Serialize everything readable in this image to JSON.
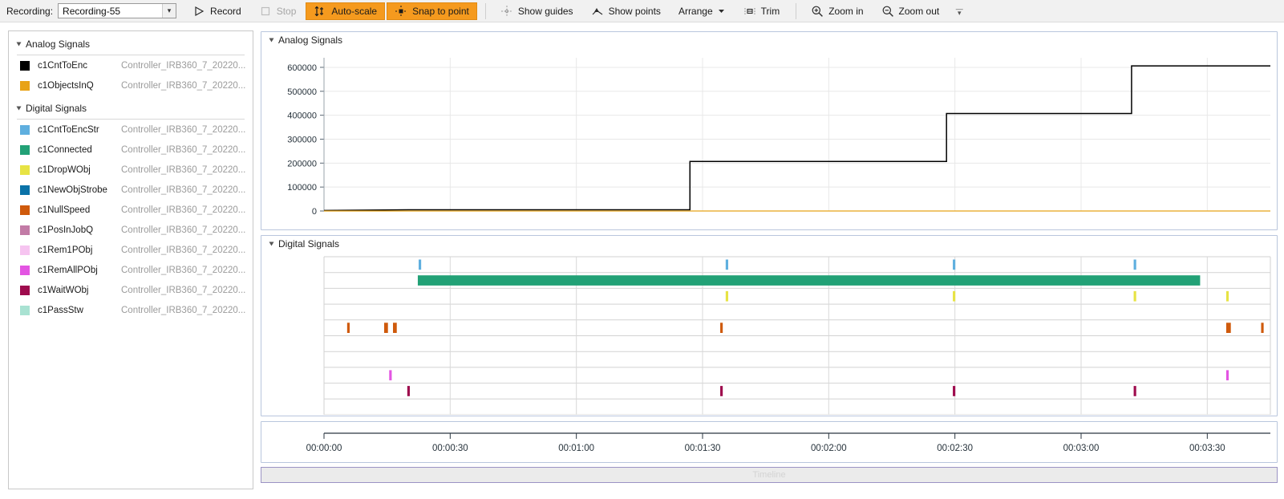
{
  "toolbar": {
    "recording_label": "Recording:",
    "recording_value": "Recording-55",
    "record_label": "Record",
    "stop_label": "Stop",
    "autoscale_label": "Auto-scale",
    "snap_label": "Snap to point",
    "show_guides_label": "Show guides",
    "show_points_label": "Show points",
    "arrange_label": "Arrange",
    "trim_label": "Trim",
    "zoom_in_label": "Zoom in",
    "zoom_out_label": "Zoom out",
    "accent_color": "#f59a1e"
  },
  "sidebar": {
    "groups": [
      {
        "title": "Analog Signals",
        "signals": [
          {
            "name": "c1CntToEnc",
            "source": "Controller_IRB360_7_20220...",
            "color": "#000000"
          },
          {
            "name": "c1ObjectsInQ",
            "source": "Controller_IRB360_7_20220...",
            "color": "#e8a317"
          }
        ]
      },
      {
        "title": "Digital Signals",
        "signals": [
          {
            "name": "c1CntToEncStr",
            "source": "Controller_IRB360_7_20220...",
            "color": "#5fafdf"
          },
          {
            "name": "c1Connected",
            "source": "Controller_IRB360_7_20220...",
            "color": "#22a176"
          },
          {
            "name": "c1DropWObj",
            "source": "Controller_IRB360_7_20220...",
            "color": "#e7e344"
          },
          {
            "name": "c1NewObjStrobe",
            "source": "Controller_IRB360_7_20220...",
            "color": "#0a72a8"
          },
          {
            "name": "c1NullSpeed",
            "source": "Controller_IRB360_7_20220...",
            "color": "#cf5a0c"
          },
          {
            "name": "c1PosInJobQ",
            "source": "Controller_IRB360_7_20220...",
            "color": "#c27ba6"
          },
          {
            "name": "c1Rem1PObj",
            "source": "Controller_IRB360_7_20220...",
            "color": "#f6c4f0"
          },
          {
            "name": "c1RemAllPObj",
            "source": "Controller_IRB360_7_20220...",
            "color": "#e355e2"
          },
          {
            "name": "c1WaitWObj",
            "source": "Controller_IRB360_7_20220...",
            "color": "#9e0b4d"
          },
          {
            "name": "c1PassStw",
            "source": "Controller_IRB360_7_20220...",
            "color": "#a9e2d2"
          }
        ]
      }
    ]
  },
  "analog_panel": {
    "title": "Analog Signals"
  },
  "digital_panel": {
    "title": "Digital Signals"
  },
  "timeline": {
    "scrollbar_label": "Timeline",
    "ticks": [
      "00:00:00",
      "00:00:30",
      "00:01:00",
      "00:01:30",
      "00:02:00",
      "00:02:30",
      "00:03:00",
      "00:03:30"
    ]
  },
  "chart_data": [
    {
      "type": "line",
      "title": "Analog Signals",
      "xlabel": "",
      "ylabel": "",
      "ylim": [
        0,
        640000
      ],
      "yticks": [
        0,
        100000,
        200000,
        300000,
        400000,
        500000,
        600000
      ],
      "ytick_labels": [
        "0",
        "100000",
        "200000",
        "300000",
        "400000",
        "500000",
        "600000"
      ],
      "xlim_seconds": [
        0,
        225
      ],
      "xticks_seconds": [
        0,
        30,
        60,
        90,
        120,
        150,
        180,
        210
      ],
      "grid": true,
      "legend": "none",
      "series": [
        {
          "name": "c1CntToEnc",
          "color": "#000000",
          "style": "step",
          "points": [
            {
              "t": 0,
              "v": 2000
            },
            {
              "t": 20,
              "v": 5000
            },
            {
              "t": 87,
              "v": 5000
            },
            {
              "t": 87,
              "v": 207000
            },
            {
              "t": 148,
              "v": 207000
            },
            {
              "t": 148,
              "v": 407000
            },
            {
              "t": 192,
              "v": 407000
            },
            {
              "t": 192,
              "v": 606000
            },
            {
              "t": 225,
              "v": 606000
            }
          ]
        },
        {
          "name": "c1ObjectsInQ",
          "color": "#e8a317",
          "style": "step",
          "points": [
            {
              "t": 0,
              "v": 0
            },
            {
              "t": 225,
              "v": 0
            }
          ]
        }
      ]
    },
    {
      "type": "timeline",
      "title": "Digital Signals",
      "xlim_seconds": [
        0,
        225
      ],
      "xticks_seconds": [
        0,
        30,
        60,
        90,
        120,
        150,
        180,
        210
      ],
      "grid": true,
      "rows": [
        {
          "name": "c1CntToEncStr",
          "color": "#5fafdf",
          "pulses": [
            {
              "t": 22.5,
              "d": 0.6
            },
            {
              "t": 95.5,
              "d": 0.6
            },
            {
              "t": 149.5,
              "d": 0.6
            },
            {
              "t": 192.5,
              "d": 0.6
            }
          ]
        },
        {
          "name": "c1Connected",
          "color": "#22a176",
          "pulses": [
            {
              "t": 22.3,
              "d": 186.0
            }
          ]
        },
        {
          "name": "c1DropWObj",
          "color": "#e7e344",
          "pulses": [
            {
              "t": 95.5,
              "d": 0.6
            },
            {
              "t": 149.5,
              "d": 0.6
            },
            {
              "t": 192.5,
              "d": 0.6
            },
            {
              "t": 214.5,
              "d": 0.6
            }
          ]
        },
        {
          "name": "c1NewObjStrobe",
          "color": "#0a72a8",
          "pulses": []
        },
        {
          "name": "c1NullSpeed",
          "color": "#cf5a0c",
          "pulses": [
            {
              "t": 5.5,
              "d": 0.6
            },
            {
              "t": 14.3,
              "d": 0.9
            },
            {
              "t": 16.4,
              "d": 0.9
            },
            {
              "t": 94.2,
              "d": 0.6
            },
            {
              "t": 214.5,
              "d": 1.1
            },
            {
              "t": 222.8,
              "d": 0.6
            }
          ]
        },
        {
          "name": "c1PosInJobQ",
          "color": "#c27ba6",
          "pulses": []
        },
        {
          "name": "c1Rem1PObj",
          "color": "#f6c4f0",
          "pulses": []
        },
        {
          "name": "c1RemAllPObj",
          "color": "#e355e2",
          "pulses": [
            {
              "t": 15.5,
              "d": 0.6
            },
            {
              "t": 214.5,
              "d": 0.6
            }
          ]
        },
        {
          "name": "c1WaitWObj",
          "color": "#9e0b4d",
          "pulses": [
            {
              "t": 19.8,
              "d": 0.6
            },
            {
              "t": 94.2,
              "d": 0.6
            },
            {
              "t": 149.5,
              "d": 0.6
            },
            {
              "t": 192.5,
              "d": 0.6
            }
          ]
        },
        {
          "name": "c1PassStw",
          "color": "#a9e2d2",
          "pulses": []
        }
      ]
    }
  ]
}
